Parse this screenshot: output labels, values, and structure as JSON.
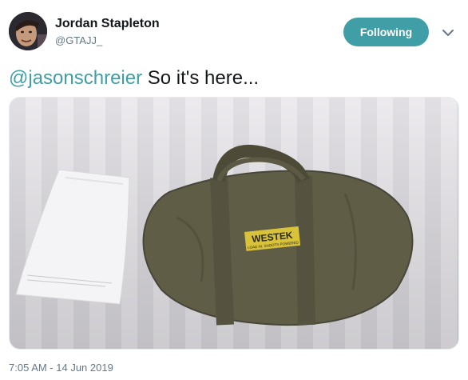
{
  "tweet": {
    "author_name": "Jordan Stapleton",
    "author_handle": "@GTAJJ_",
    "follow_label": "Following",
    "mention": "@jasonschreier",
    "text": "So it's here...",
    "timestamp": "7:05 AM - 14 Jun 2019"
  },
  "media": {
    "bag_brand": "WESTEK",
    "bag_tagline": "LOAD IN. SHOOTS POWERED"
  },
  "colors": {
    "accent": "#3f9ea6",
    "secondary_text": "#657786",
    "primary_text": "#14171a"
  },
  "icons": {
    "more": "chevron-down-icon"
  }
}
